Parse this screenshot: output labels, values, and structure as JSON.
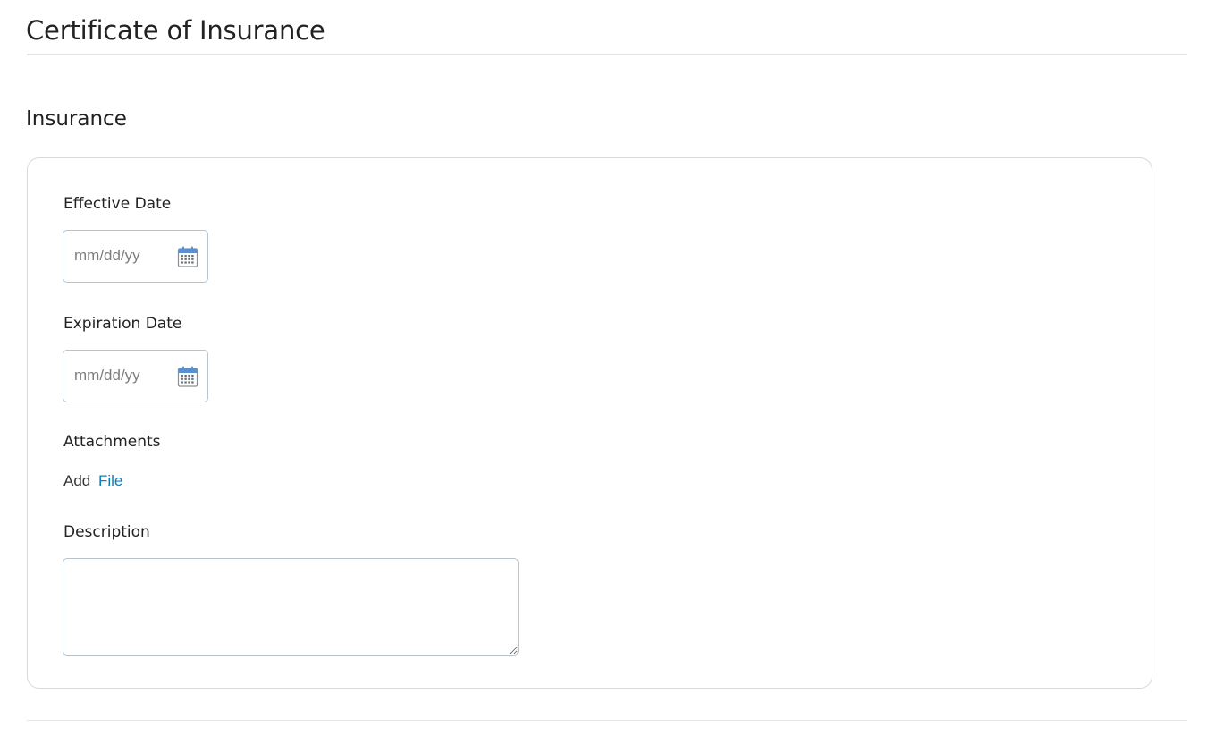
{
  "page": {
    "title": "Certificate of Insurance"
  },
  "section": {
    "title": "Insurance"
  },
  "form": {
    "effective_date": {
      "label": "Effective Date",
      "value": "",
      "placeholder": "mm/dd/yy",
      "icon": "calendar-icon"
    },
    "expiration_date": {
      "label": "Expiration Date",
      "value": "",
      "placeholder": "mm/dd/yy",
      "icon": "calendar-icon"
    },
    "attachments": {
      "label": "Attachments",
      "add_text": "Add",
      "file_link": "File"
    },
    "description": {
      "label": "Description",
      "value": ""
    }
  },
  "colors": {
    "link": "#0a7fc2",
    "calendar_accent": "#5a8fd0",
    "field_border": "#b7c3cd",
    "card_border": "#d7d9db"
  }
}
